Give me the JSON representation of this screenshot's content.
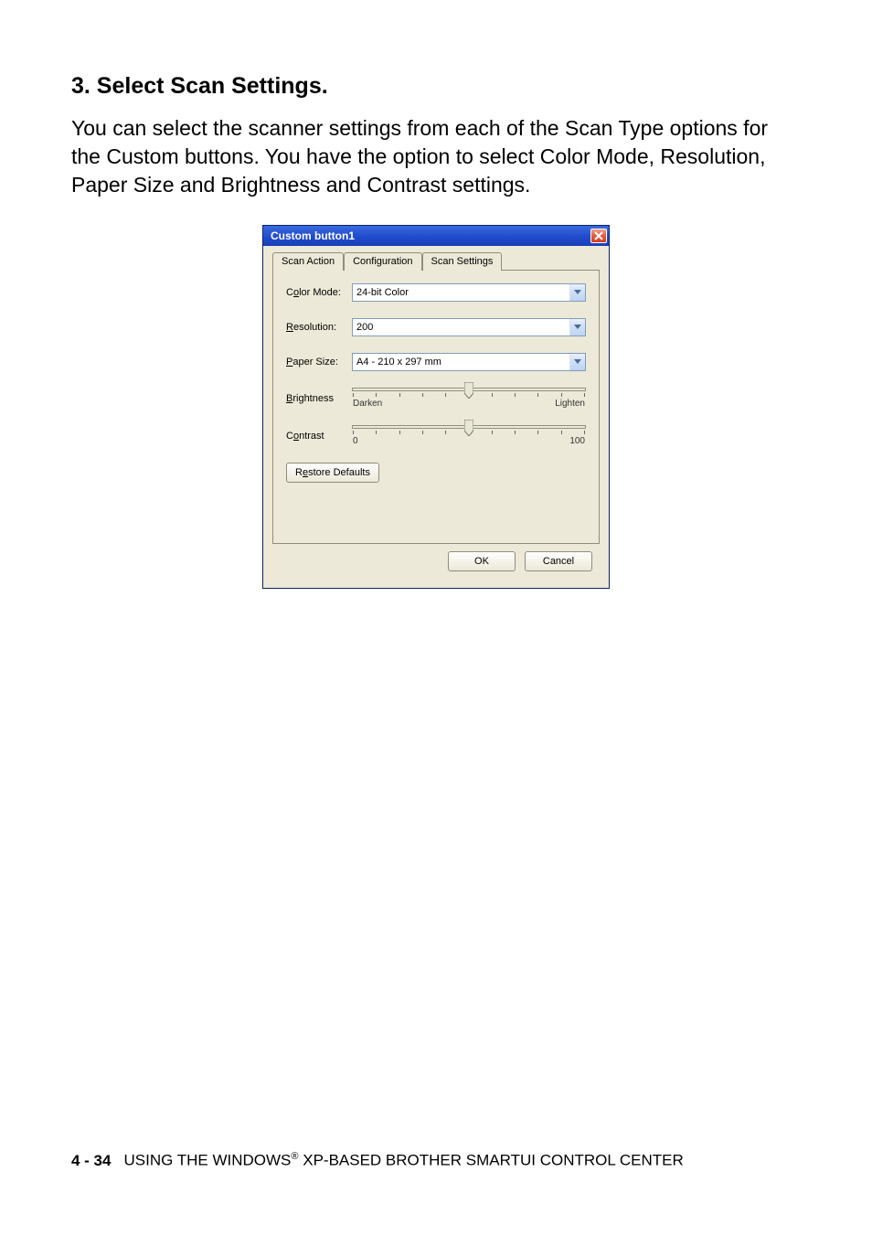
{
  "heading": "3. Select Scan Settings.",
  "paragraph": "You can select the scanner settings from each of the Scan Type options for the Custom buttons. You have the option to select Color Mode, Resolution, Paper Size and Brightness and Contrast settings.",
  "dialog": {
    "title": "Custom button1",
    "tabs": [
      "Scan Action",
      "Configuration",
      "Scan Settings"
    ],
    "active_tab": 2,
    "labels": {
      "color_mode_pre": "C",
      "color_mode_u": "o",
      "color_mode_post": "lor Mode:",
      "resolution_u": "R",
      "resolution_post": "esolution:",
      "paper_u": "P",
      "paper_post": "aper Size:",
      "brightness_u": "B",
      "brightness_post": "rightness",
      "contrast_pre": "C",
      "contrast_u": "o",
      "contrast_post": "ntrast"
    },
    "values": {
      "color_mode": "24-bit Color",
      "resolution": "200",
      "paper_size": "A4 - 210 x 297 mm"
    },
    "brightness": {
      "left": "Darken",
      "right": "Lighten"
    },
    "contrast": {
      "left": "0",
      "right": "100"
    },
    "restore_pre": "R",
    "restore_u": "e",
    "restore_post": "store Defaults",
    "ok": "OK",
    "cancel": "Cancel"
  },
  "footer": {
    "page": "4 - 34",
    "text_pre": "USING THE WINDOWS",
    "reg": "®",
    "text_post": " XP-BASED BROTHER SMARTUI CONTROL CENTER"
  }
}
